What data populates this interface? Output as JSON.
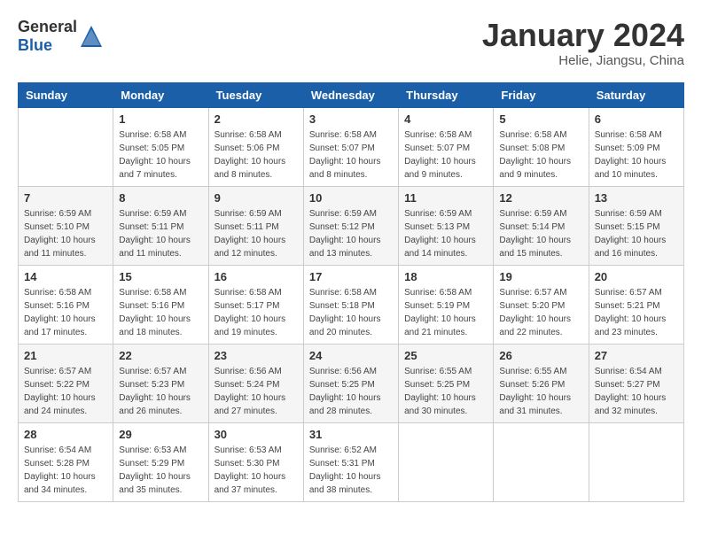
{
  "header": {
    "logo_general": "General",
    "logo_blue": "Blue",
    "month_title": "January 2024",
    "subtitle": "Helie, Jiangsu, China"
  },
  "weekdays": [
    "Sunday",
    "Monday",
    "Tuesday",
    "Wednesday",
    "Thursday",
    "Friday",
    "Saturday"
  ],
  "weeks": [
    [
      {
        "day": "",
        "info": ""
      },
      {
        "day": "1",
        "info": "Sunrise: 6:58 AM\nSunset: 5:05 PM\nDaylight: 10 hours\nand 7 minutes."
      },
      {
        "day": "2",
        "info": "Sunrise: 6:58 AM\nSunset: 5:06 PM\nDaylight: 10 hours\nand 8 minutes."
      },
      {
        "day": "3",
        "info": "Sunrise: 6:58 AM\nSunset: 5:07 PM\nDaylight: 10 hours\nand 8 minutes."
      },
      {
        "day": "4",
        "info": "Sunrise: 6:58 AM\nSunset: 5:07 PM\nDaylight: 10 hours\nand 9 minutes."
      },
      {
        "day": "5",
        "info": "Sunrise: 6:58 AM\nSunset: 5:08 PM\nDaylight: 10 hours\nand 9 minutes."
      },
      {
        "day": "6",
        "info": "Sunrise: 6:58 AM\nSunset: 5:09 PM\nDaylight: 10 hours\nand 10 minutes."
      }
    ],
    [
      {
        "day": "7",
        "info": "Sunrise: 6:59 AM\nSunset: 5:10 PM\nDaylight: 10 hours\nand 11 minutes."
      },
      {
        "day": "8",
        "info": "Sunrise: 6:59 AM\nSunset: 5:11 PM\nDaylight: 10 hours\nand 11 minutes."
      },
      {
        "day": "9",
        "info": "Sunrise: 6:59 AM\nSunset: 5:11 PM\nDaylight: 10 hours\nand 12 minutes."
      },
      {
        "day": "10",
        "info": "Sunrise: 6:59 AM\nSunset: 5:12 PM\nDaylight: 10 hours\nand 13 minutes."
      },
      {
        "day": "11",
        "info": "Sunrise: 6:59 AM\nSunset: 5:13 PM\nDaylight: 10 hours\nand 14 minutes."
      },
      {
        "day": "12",
        "info": "Sunrise: 6:59 AM\nSunset: 5:14 PM\nDaylight: 10 hours\nand 15 minutes."
      },
      {
        "day": "13",
        "info": "Sunrise: 6:59 AM\nSunset: 5:15 PM\nDaylight: 10 hours\nand 16 minutes."
      }
    ],
    [
      {
        "day": "14",
        "info": "Sunrise: 6:58 AM\nSunset: 5:16 PM\nDaylight: 10 hours\nand 17 minutes."
      },
      {
        "day": "15",
        "info": "Sunrise: 6:58 AM\nSunset: 5:16 PM\nDaylight: 10 hours\nand 18 minutes."
      },
      {
        "day": "16",
        "info": "Sunrise: 6:58 AM\nSunset: 5:17 PM\nDaylight: 10 hours\nand 19 minutes."
      },
      {
        "day": "17",
        "info": "Sunrise: 6:58 AM\nSunset: 5:18 PM\nDaylight: 10 hours\nand 20 minutes."
      },
      {
        "day": "18",
        "info": "Sunrise: 6:58 AM\nSunset: 5:19 PM\nDaylight: 10 hours\nand 21 minutes."
      },
      {
        "day": "19",
        "info": "Sunrise: 6:57 AM\nSunset: 5:20 PM\nDaylight: 10 hours\nand 22 minutes."
      },
      {
        "day": "20",
        "info": "Sunrise: 6:57 AM\nSunset: 5:21 PM\nDaylight: 10 hours\nand 23 minutes."
      }
    ],
    [
      {
        "day": "21",
        "info": "Sunrise: 6:57 AM\nSunset: 5:22 PM\nDaylight: 10 hours\nand 24 minutes."
      },
      {
        "day": "22",
        "info": "Sunrise: 6:57 AM\nSunset: 5:23 PM\nDaylight: 10 hours\nand 26 minutes."
      },
      {
        "day": "23",
        "info": "Sunrise: 6:56 AM\nSunset: 5:24 PM\nDaylight: 10 hours\nand 27 minutes."
      },
      {
        "day": "24",
        "info": "Sunrise: 6:56 AM\nSunset: 5:25 PM\nDaylight: 10 hours\nand 28 minutes."
      },
      {
        "day": "25",
        "info": "Sunrise: 6:55 AM\nSunset: 5:25 PM\nDaylight: 10 hours\nand 30 minutes."
      },
      {
        "day": "26",
        "info": "Sunrise: 6:55 AM\nSunset: 5:26 PM\nDaylight: 10 hours\nand 31 minutes."
      },
      {
        "day": "27",
        "info": "Sunrise: 6:54 AM\nSunset: 5:27 PM\nDaylight: 10 hours\nand 32 minutes."
      }
    ],
    [
      {
        "day": "28",
        "info": "Sunrise: 6:54 AM\nSunset: 5:28 PM\nDaylight: 10 hours\nand 34 minutes."
      },
      {
        "day": "29",
        "info": "Sunrise: 6:53 AM\nSunset: 5:29 PM\nDaylight: 10 hours\nand 35 minutes."
      },
      {
        "day": "30",
        "info": "Sunrise: 6:53 AM\nSunset: 5:30 PM\nDaylight: 10 hours\nand 37 minutes."
      },
      {
        "day": "31",
        "info": "Sunrise: 6:52 AM\nSunset: 5:31 PM\nDaylight: 10 hours\nand 38 minutes."
      },
      {
        "day": "",
        "info": ""
      },
      {
        "day": "",
        "info": ""
      },
      {
        "day": "",
        "info": ""
      }
    ]
  ]
}
